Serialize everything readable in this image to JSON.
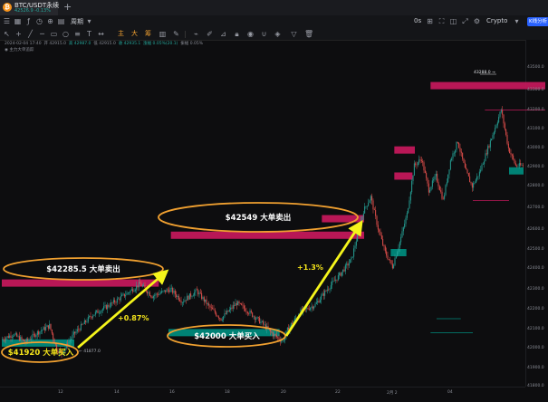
{
  "tab": {
    "title": "BTC/USDT永续",
    "subtitle": "42526.9 -0.13%",
    "logo": "₿"
  },
  "toolbar": {
    "timeframe": "周期",
    "interval": "0s",
    "broker": "Crypto",
    "ai_button": "K线分析",
    "cn_tools": [
      "主",
      "大",
      "筹"
    ]
  },
  "info": {
    "line1_date": "2024-02-04 17:40",
    "line1_open": "开 42915.0",
    "line1_high": "高 42987.0",
    "line1_low": "低 42915.0",
    "line1_close": "收 42935.1",
    "line1_change": "涨幅 0.05%(20.1)",
    "line1_amp": "振幅 0.05%",
    "line2": "主力大单追踪"
  },
  "annotations": {
    "sell1": "$42285.5 大单卖出",
    "sell2": "$42549 大单卖出",
    "buy1": "$41920 大单买入",
    "buy2": "$42000 大单买入",
    "pct1": "+0.87%",
    "pct2": "+1.3%",
    "min_label": "← 41877.0",
    "max_label": "43288.0 →"
  },
  "price_ticks": [
    "43500.0",
    "43300.0",
    "43200.0",
    "43100.0",
    "43000.0",
    "42900.0",
    "42800.0",
    "42700.0",
    "42600.0",
    "42500.0",
    "42400.0",
    "42300.0",
    "42200.0",
    "42100.0",
    "42000.0",
    "41900.0",
    "41800.0",
    "41700.0"
  ],
  "time_ticks": [
    "12",
    "14",
    "16",
    "18",
    "20",
    "22",
    "2月 2",
    "04"
  ],
  "colors": {
    "up": "#26a69a",
    "down": "#ef5350",
    "sell_block": "#c2185b",
    "buy_block": "#00897b",
    "ellipse": "#f0a030",
    "arrow": "#f5f51b"
  },
  "chart_data": {
    "type": "candlestick",
    "ylim": [
      41700,
      43600
    ],
    "start_price": 41960,
    "path": [
      [
        0,
        41960
      ],
      [
        10,
        41990
      ],
      [
        20,
        41945
      ],
      [
        30,
        42000
      ],
      [
        40,
        42040
      ],
      [
        46,
        41905
      ],
      [
        50,
        41880
      ],
      [
        60,
        41990
      ],
      [
        75,
        42100
      ],
      [
        90,
        42160
      ],
      [
        105,
        42230
      ],
      [
        115,
        42280
      ],
      [
        125,
        42210
      ],
      [
        140,
        42250
      ],
      [
        150,
        42180
      ],
      [
        162,
        42240
      ],
      [
        172,
        42150
      ],
      [
        182,
        42080
      ],
      [
        195,
        42170
      ],
      [
        205,
        42120
      ],
      [
        215,
        42060
      ],
      [
        225,
        41990
      ],
      [
        233,
        41950
      ],
      [
        238,
        42030
      ],
      [
        248,
        42120
      ],
      [
        260,
        42160
      ],
      [
        270,
        42250
      ],
      [
        280,
        42330
      ],
      [
        290,
        42420
      ],
      [
        295,
        42560
      ],
      [
        300,
        42700
      ],
      [
        306,
        42780
      ],
      [
        312,
        42600
      ],
      [
        318,
        42460
      ],
      [
        324,
        42380
      ],
      [
        330,
        42520
      ],
      [
        336,
        42680
      ],
      [
        342,
        42960
      ],
      [
        348,
        43000
      ],
      [
        354,
        42820
      ],
      [
        360,
        42900
      ],
      [
        366,
        42760
      ],
      [
        372,
        42990
      ],
      [
        378,
        43100
      ],
      [
        384,
        42940
      ],
      [
        390,
        42840
      ],
      [
        396,
        42920
      ],
      [
        402,
        43040
      ],
      [
        408,
        43160
      ],
      [
        414,
        43280
      ],
      [
        420,
        43060
      ],
      [
        426,
        42960
      ],
      [
        432,
        42960
      ]
    ],
    "big_orders": [
      {
        "side": "sell",
        "price": 43420,
        "from": 355,
        "to": 450
      },
      {
        "side": "sell",
        "price": 43050,
        "from": 325,
        "to": 342
      },
      {
        "side": "sell",
        "price": 42900,
        "from": 325,
        "to": 340
      },
      {
        "side": "sell",
        "price": 42655,
        "from": 265,
        "to": 300
      },
      {
        "side": "sell",
        "price": 42560,
        "from": 140,
        "to": 300
      },
      {
        "side": "sell",
        "price": 42285,
        "from": 0,
        "to": 130
      },
      {
        "side": "buy",
        "price": 42930,
        "from": 420,
        "to": 432
      },
      {
        "side": "buy",
        "price": 42460,
        "from": 322,
        "to": 335
      },
      {
        "side": "buy",
        "price": 42000,
        "from": 138,
        "to": 230
      },
      {
        "side": "buy",
        "price": 41940,
        "from": 0,
        "to": 60
      }
    ]
  }
}
